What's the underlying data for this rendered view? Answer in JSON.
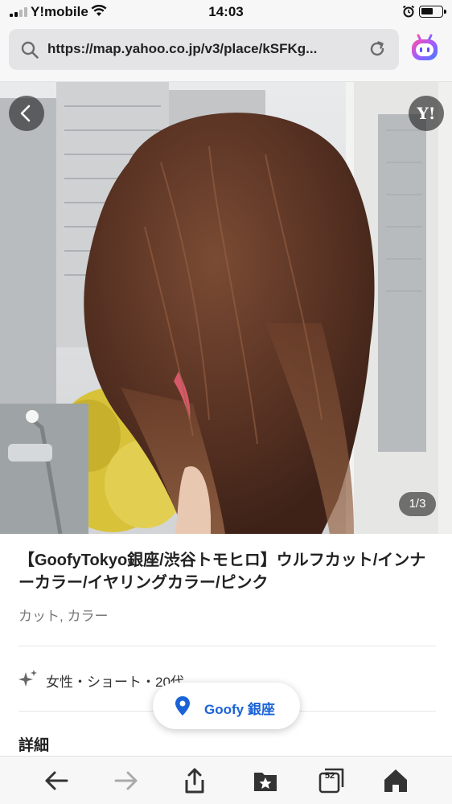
{
  "status_bar": {
    "carrier": "Y!mobile",
    "time": "14:03"
  },
  "browser": {
    "url": "https://map.yahoo.co.jp/v3/place/kSFKg...",
    "icons": [
      "search-icon",
      "reload-icon",
      "assistant-icon"
    ]
  },
  "gallery": {
    "counter": "1/3",
    "logo_text": "Y!",
    "icons": [
      "back-arrow-icon"
    ]
  },
  "listing": {
    "title": "【GoofyTokyo銀座/渋谷トモヒロ】ウルフカット/インナーカラー/イヤリングカラー/ピンク",
    "tags": "カット, カラー",
    "attributes": "女性・ショート・20代",
    "section_heading": "詳細"
  },
  "location_pill": {
    "label": "Goofy 銀座",
    "icon": "map-pin-icon",
    "color": "#1a63d6"
  },
  "toolbar": {
    "tab_count": "52",
    "icons": [
      "back-icon",
      "forward-icon",
      "share-icon",
      "bookmarks-icon",
      "tabs-icon",
      "home-icon"
    ]
  }
}
